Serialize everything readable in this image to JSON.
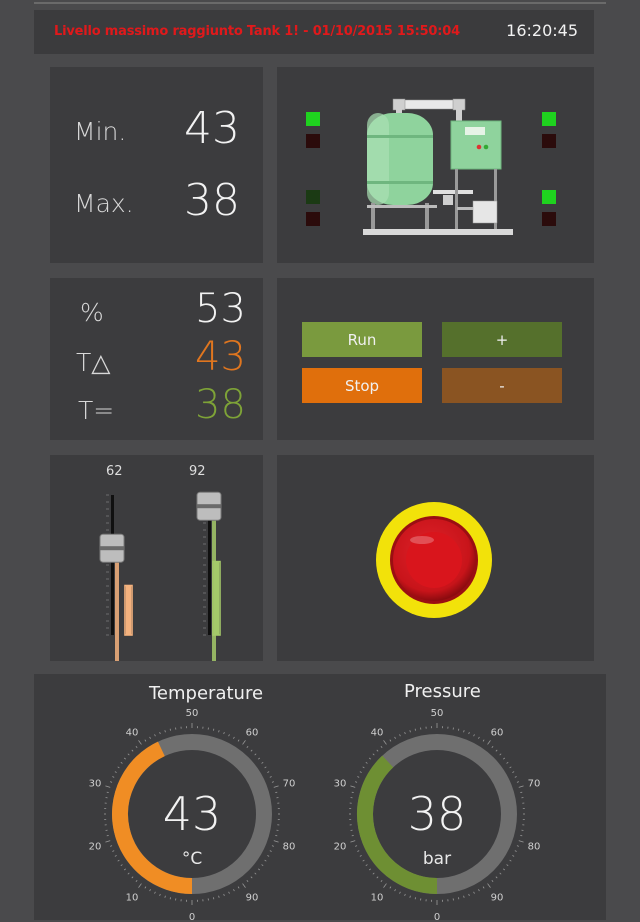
{
  "alarm": {
    "message": "Livello massimo raggiunto Tank 1! - 01/10/2015 15:50:04",
    "time": "16:20:45"
  },
  "levels": {
    "min_label": "Min.",
    "min_value": "43",
    "max_label": "Max.",
    "max_value": "38"
  },
  "readings": {
    "percent_label": "%",
    "percent_value": "53",
    "tdelta_label": "T△",
    "tdelta_value": "43",
    "tequal_label": "T=",
    "tequal_value": "38",
    "colors": {
      "tdelta": "#e0761f",
      "tequal": "#7ea337"
    }
  },
  "controls": {
    "run": "Run",
    "stop": "Stop",
    "plus": "+",
    "minus": "-",
    "colors": {
      "run": "#7a9a3e",
      "stop": "#e06f0c",
      "plus": "#55702c",
      "minus": "#8a5422"
    }
  },
  "sliders": [
    {
      "label": "62",
      "level": 0.62,
      "color": "#f4b27e"
    },
    {
      "label": "92",
      "level": 0.92,
      "color": "#a4c96a"
    }
  ],
  "leds": {
    "left": [
      "on",
      "off",
      "dim",
      "off"
    ],
    "right": [
      "on",
      "off",
      "on",
      "off"
    ]
  },
  "emergency_stop": {
    "icon": "emergency-stop-icon"
  },
  "gauges": {
    "temperature": {
      "title": "Temperature",
      "value": "43",
      "unit": "°C",
      "numeric": 43,
      "min": 0,
      "max": 100,
      "color": "#f08d24",
      "ticks": [
        "0",
        "10",
        "20",
        "30",
        "40",
        "50",
        "60",
        "70",
        "80",
        "90"
      ]
    },
    "pressure": {
      "title": "Pressure",
      "value": "38",
      "unit": "bar",
      "numeric": 38,
      "min": 0,
      "max": 100,
      "color": "#6e8f33",
      "ticks": [
        "0",
        "10",
        "20",
        "30",
        "40",
        "50",
        "60",
        "70",
        "80",
        "90"
      ]
    }
  }
}
